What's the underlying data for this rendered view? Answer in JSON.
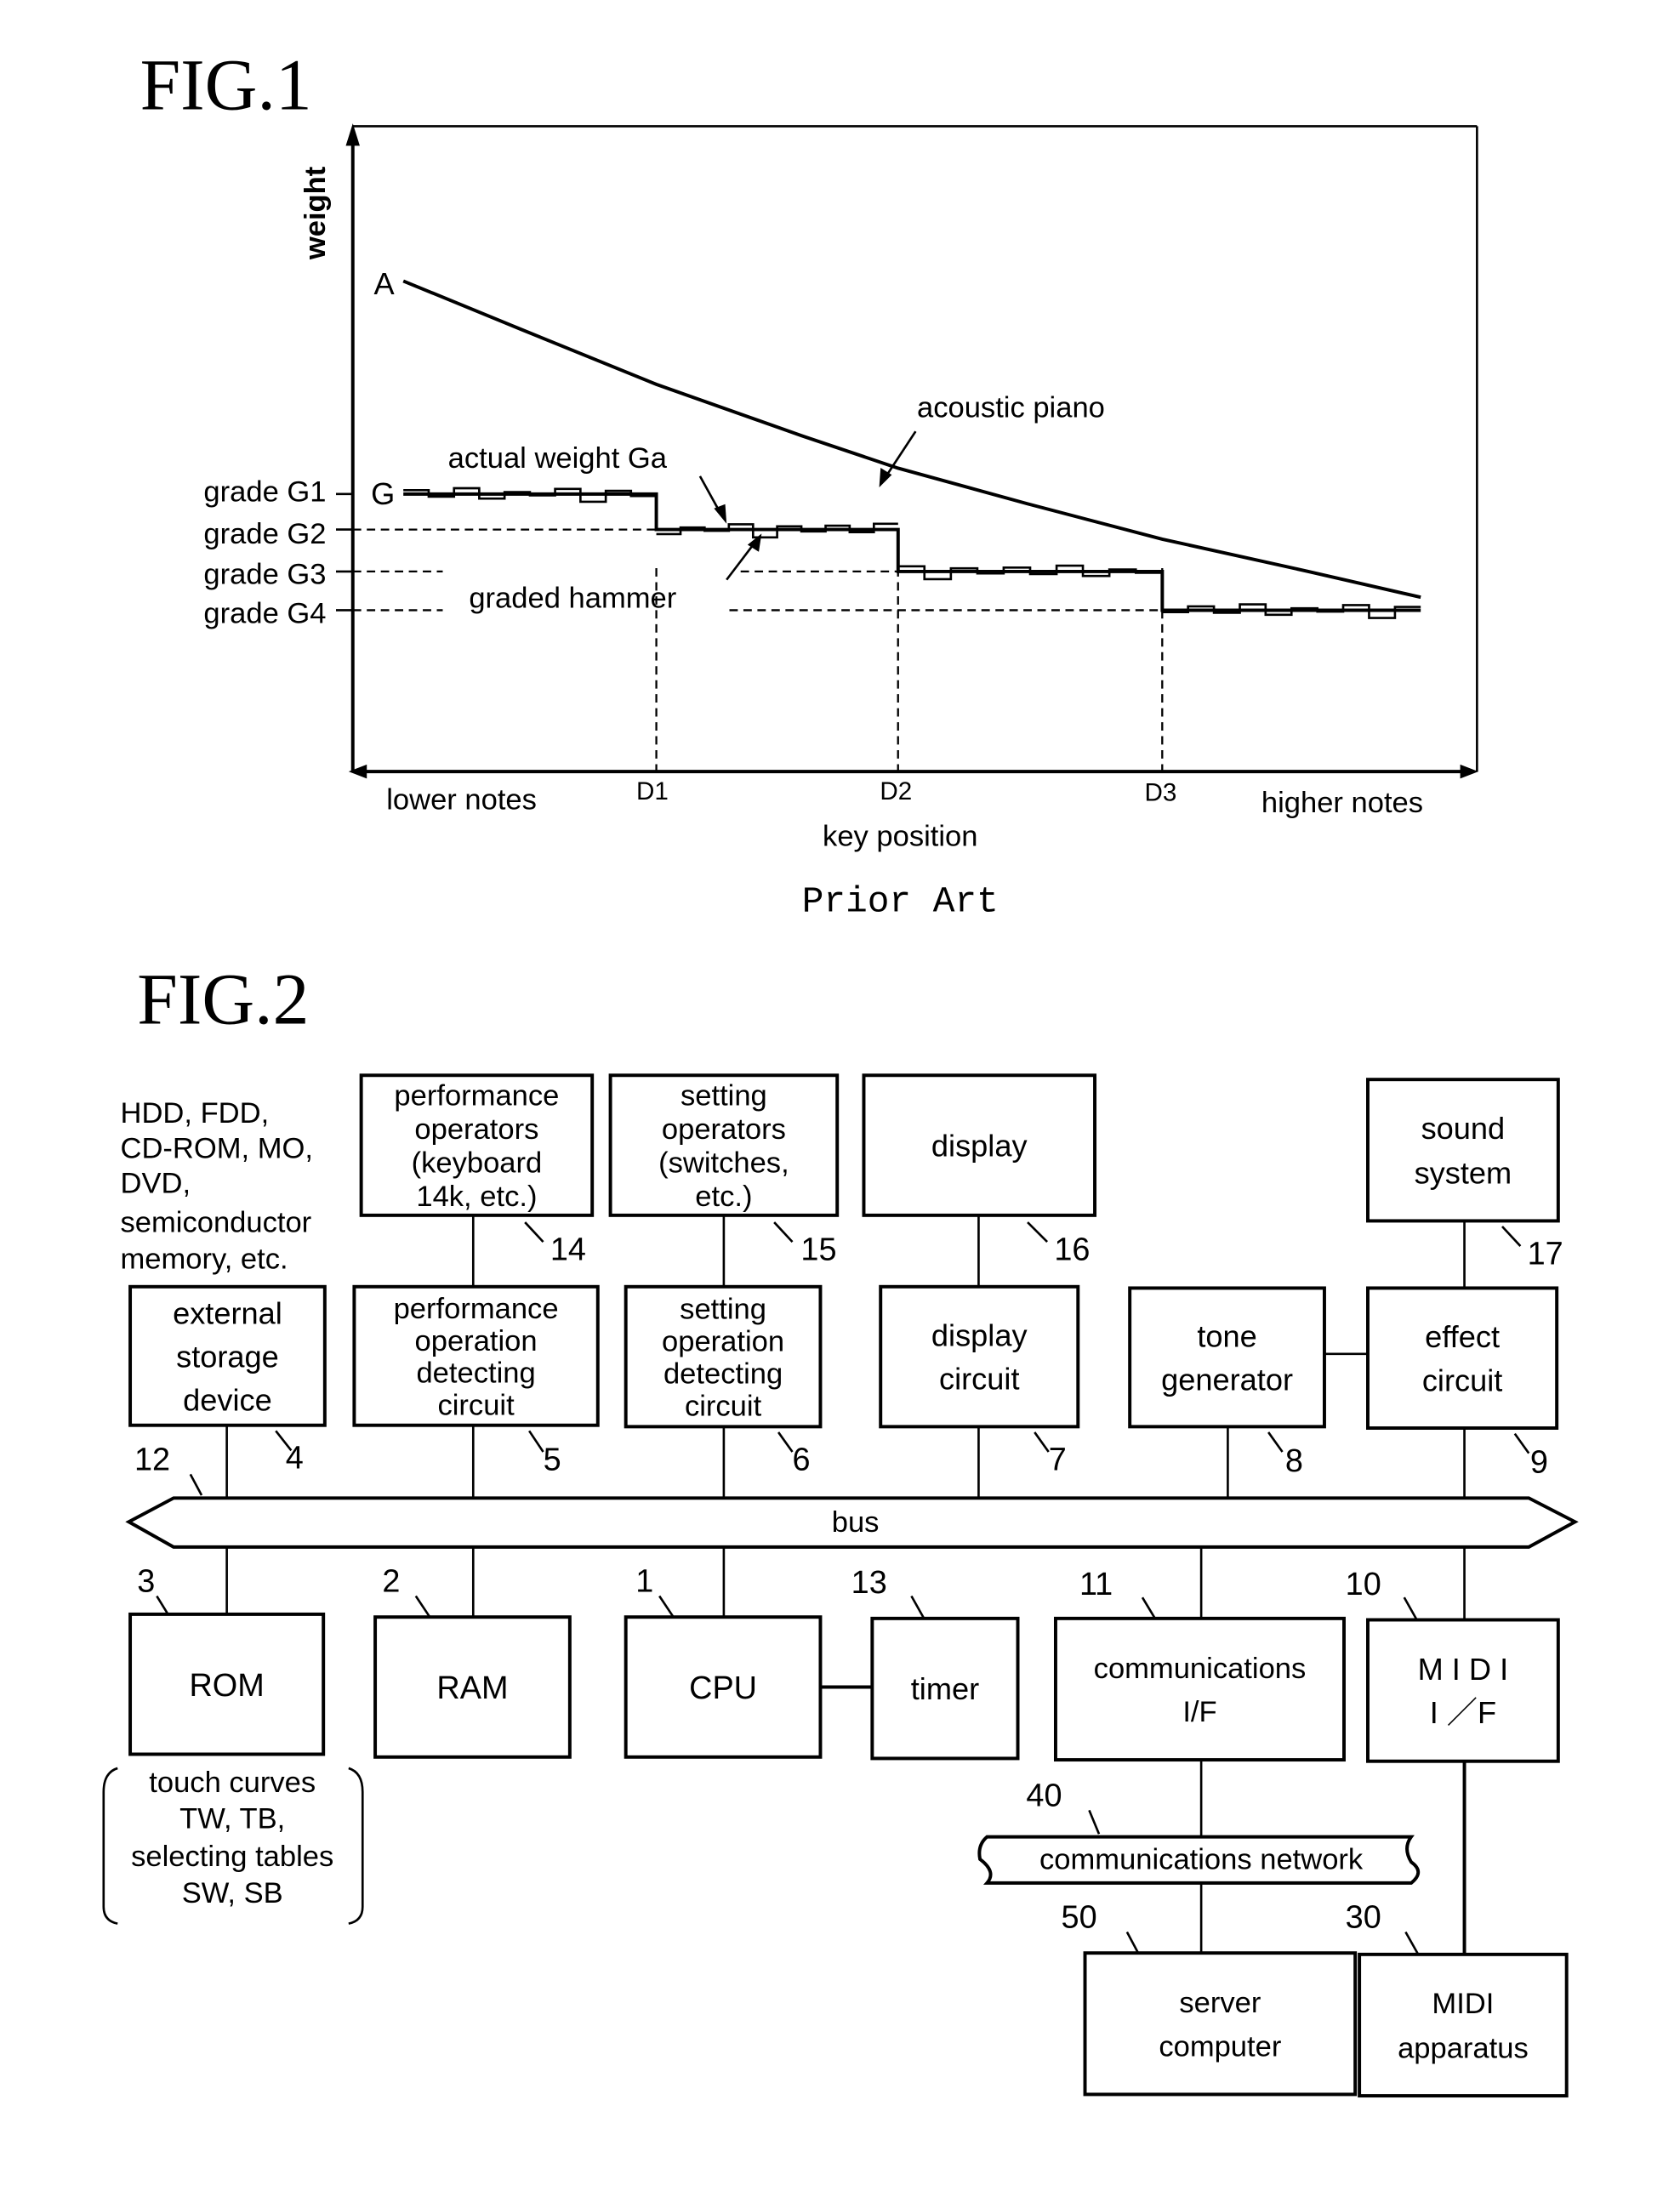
{
  "fig1": {
    "title": "FIG.1",
    "caption": "Prior Art",
    "chart_data": {
      "type": "line",
      "title": "FIG.1",
      "xlabel": "key position",
      "ylabel": "weight",
      "x_left_label": "lower notes",
      "x_right_label": "higher notes",
      "x_ticks": [
        "D1",
        "D2",
        "D3"
      ],
      "y_ticks": [
        "grade G1",
        "grade G2",
        "grade G3",
        "grade G4"
      ],
      "grid": false,
      "legend": "none",
      "annotations": {
        "curve_a_point": "A",
        "graded_start_point": "G",
        "acoustic": "acoustic piano",
        "actual": "actual weight Ga",
        "graded": "graded hammer"
      },
      "x_domain": [
        0,
        100
      ],
      "y_domain": [
        0,
        100
      ],
      "segment_boundaries": {
        "D1": 27,
        "D2": 48.5,
        "D3": 72
      },
      "grade_levels": {
        "G1": 43,
        "G2": 37.5,
        "G3": 31,
        "G4": 25
      },
      "series": [
        {
          "name": "acoustic piano",
          "points": [
            [
              4.5,
              76
            ],
            [
              15,
              68.5
            ],
            [
              27,
              60
            ],
            [
              40,
              52
            ],
            [
              48.5,
              47
            ],
            [
              60,
              41.5
            ],
            [
              72,
              36
            ],
            [
              85,
              31
            ],
            [
              95,
              27
            ]
          ]
        },
        {
          "name": "graded hammer",
          "steps": [
            {
              "from": 4.5,
              "to": 27,
              "level": "G1"
            },
            {
              "from": 27,
              "to": 48.5,
              "level": "G2"
            },
            {
              "from": 48.5,
              "to": 72,
              "level": "G3"
            },
            {
              "from": 72,
              "to": 95,
              "level": "G4"
            }
          ]
        },
        {
          "name": "actual weight Ga",
          "description": "small stepwise deviations around each grade level"
        }
      ]
    }
  },
  "fig2": {
    "title": "FIG.2",
    "storage_note": [
      "HDD, FDD,",
      "CD-ROM, MO,",
      "DVD,",
      "semiconductor",
      "memory, etc."
    ],
    "rom_note": [
      "touch curves",
      "TW, TB,",
      "selecting tables",
      "SW, SB"
    ],
    "bus": {
      "label": "bus",
      "ref": "12"
    },
    "blocks": {
      "perf_ops": {
        "lines": [
          "performance",
          "operators",
          "(keyboard",
          "14k, etc.)"
        ],
        "ref": "14"
      },
      "setting_ops": {
        "lines": [
          "setting",
          "operators",
          "(switches,",
          "etc.)"
        ],
        "ref": "15"
      },
      "display": {
        "lines": [
          "display"
        ],
        "ref": "16"
      },
      "sound": {
        "lines": [
          "sound",
          "system"
        ],
        "ref": "17"
      },
      "ext_storage": {
        "lines": [
          "external",
          "storage",
          "device"
        ],
        "ref": "4"
      },
      "perf_detect": {
        "lines": [
          "performance",
          "operation",
          "detecting",
          "circuit"
        ],
        "ref": "5"
      },
      "setting_detect": {
        "lines": [
          "setting",
          "operation",
          "detecting",
          "circuit"
        ],
        "ref": "6"
      },
      "display_circuit": {
        "lines": [
          "display",
          "circuit"
        ],
        "ref": "7"
      },
      "tone_gen": {
        "lines": [
          "tone",
          "generator"
        ],
        "ref": "8"
      },
      "effect": {
        "lines": [
          "effect",
          "circuit"
        ],
        "ref": "9"
      },
      "rom": {
        "lines": [
          "ROM"
        ],
        "ref": "3"
      },
      "ram": {
        "lines": [
          "RAM"
        ],
        "ref": "2"
      },
      "cpu": {
        "lines": [
          "CPU"
        ],
        "ref": "1"
      },
      "timer": {
        "lines": [
          "timer"
        ],
        "ref": "13"
      },
      "comm_if": {
        "lines": [
          "communications",
          "I/F"
        ],
        "ref": "11"
      },
      "midi_if": {
        "lines": [
          "M I D I",
          "I ／F"
        ],
        "ref": "10"
      },
      "server": {
        "lines": [
          "server",
          "computer"
        ],
        "ref": "50"
      },
      "midi_app": {
        "lines": [
          "MIDI",
          "apparatus"
        ],
        "ref": "30"
      }
    },
    "network": {
      "label": "communications network",
      "ref": "40"
    }
  }
}
